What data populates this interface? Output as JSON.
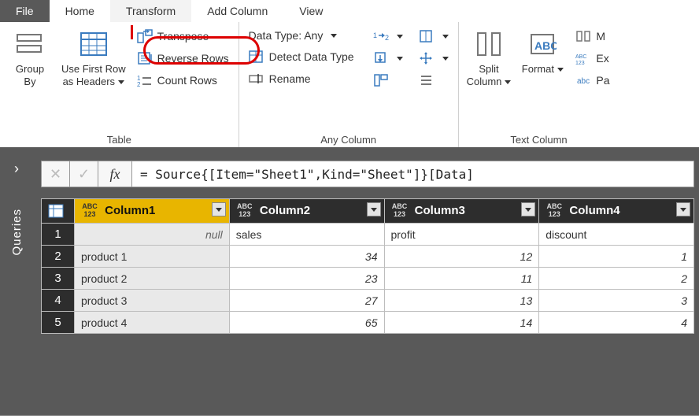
{
  "tabs": {
    "file": "File",
    "home": "Home",
    "transform": "Transform",
    "add_column": "Add Column",
    "view": "View"
  },
  "ribbon": {
    "table_group": {
      "label": "Table",
      "group_by": "Group\nBy",
      "use_first_row": "Use First Row\nas Headers",
      "transpose": "Transpose",
      "reverse_rows": "Reverse Rows",
      "count_rows": "Count Rows"
    },
    "any_column_group": {
      "label": "Any Column",
      "data_type": "Data Type: Any",
      "detect": "Detect Data Type",
      "rename": "Rename"
    },
    "text_group": {
      "label": "Text Column",
      "split": "Split\nColumn",
      "format": "Format",
      "merge_short": "M",
      "extract_short": "Ex",
      "parse_short": "Pa"
    }
  },
  "formula_bar": {
    "cancel_glyph": "✕",
    "commit_glyph": "✓",
    "fx": "fx",
    "formula": "= Source{[Item=\"Sheet1\",Kind=\"Sheet\"]}[Data]"
  },
  "sidebar": {
    "expand_glyph": "›",
    "label": "Queries"
  },
  "grid": {
    "type_badge_top": "ABC",
    "type_badge_bottom": "123",
    "columns": [
      "Column1",
      "Column2",
      "Column3",
      "Column4"
    ],
    "rows": [
      {
        "n": "1",
        "c1": "null",
        "c1_null": true,
        "c2": "sales",
        "c3": "profit",
        "c4": "discount"
      },
      {
        "n": "2",
        "c1": "product 1",
        "c2": "34",
        "c3": "12",
        "c4": "1"
      },
      {
        "n": "3",
        "c1": "product 2",
        "c2": "23",
        "c3": "11",
        "c4": "2"
      },
      {
        "n": "4",
        "c1": "product 3",
        "c2": "27",
        "c3": "13",
        "c4": "3"
      },
      {
        "n": "5",
        "c1": "product 4",
        "c2": "65",
        "c3": "14",
        "c4": "4"
      }
    ]
  }
}
